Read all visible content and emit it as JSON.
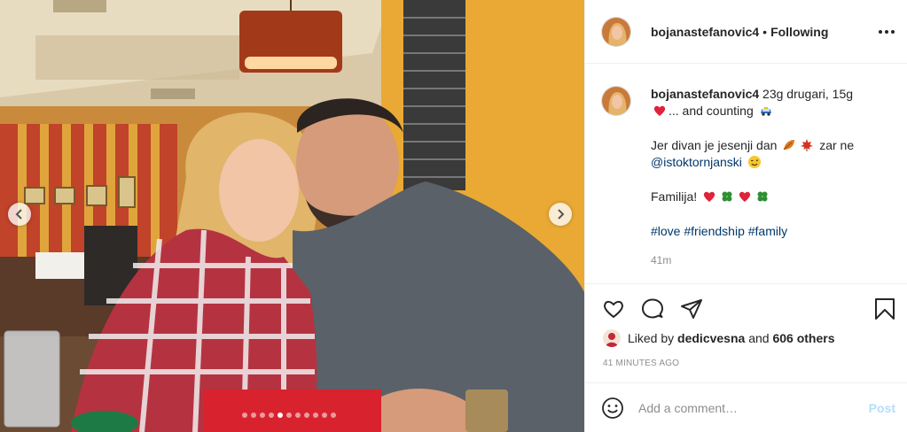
{
  "header": {
    "username": "bojanastefanovic4",
    "separator": "•",
    "follow_status": "Following"
  },
  "caption": {
    "username": "bojanastefanovic4",
    "line1": "23g drugari, 15g",
    "line2_text": "... and counting",
    "line3_prefix": "Jer divan je jesenji dan",
    "line3_suffix": "zar ne",
    "mention": "@istoktornjanski",
    "familija": "Familija!",
    "hashtags": [
      "#love",
      "#friendship",
      "#family"
    ],
    "time": "41m"
  },
  "likes": {
    "prefix": "Liked by",
    "user": "dedicvesna",
    "middle": "and",
    "others": "606 others"
  },
  "timestamp": "41 MINUTES AGO",
  "comment_box": {
    "placeholder": "Add a comment…",
    "post_label": "Post"
  },
  "carousel": {
    "total_slides": 11,
    "active_index": 4
  },
  "colors": {
    "link": "#00376b",
    "post_disabled": "#b2dffc",
    "heart": "#ed4956",
    "clover": "#3a9a3a"
  },
  "icons": [
    "heart-icon",
    "comment-icon",
    "share-icon",
    "bookmark-icon",
    "smiley-icon",
    "more-icon",
    "chevron-left-icon",
    "chevron-right-icon"
  ]
}
